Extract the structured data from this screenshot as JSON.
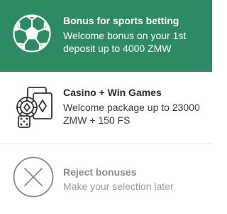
{
  "options": {
    "sports": {
      "title": "Bonus for sports betting",
      "description": "Welcome bonus on your 1st deposit up to 4000 ZMW",
      "icon": "soccer-ball-icon",
      "background": "#2e8a62"
    },
    "casino": {
      "title": "Casino + Win Games",
      "description": "Welcome package up to 23000 ZMW + 150 FS",
      "icon": "casino-cards-chip-dice-icon"
    },
    "reject": {
      "title": "Reject bonuses",
      "description": "Make your selection later",
      "icon": "close-circle-icon"
    }
  }
}
